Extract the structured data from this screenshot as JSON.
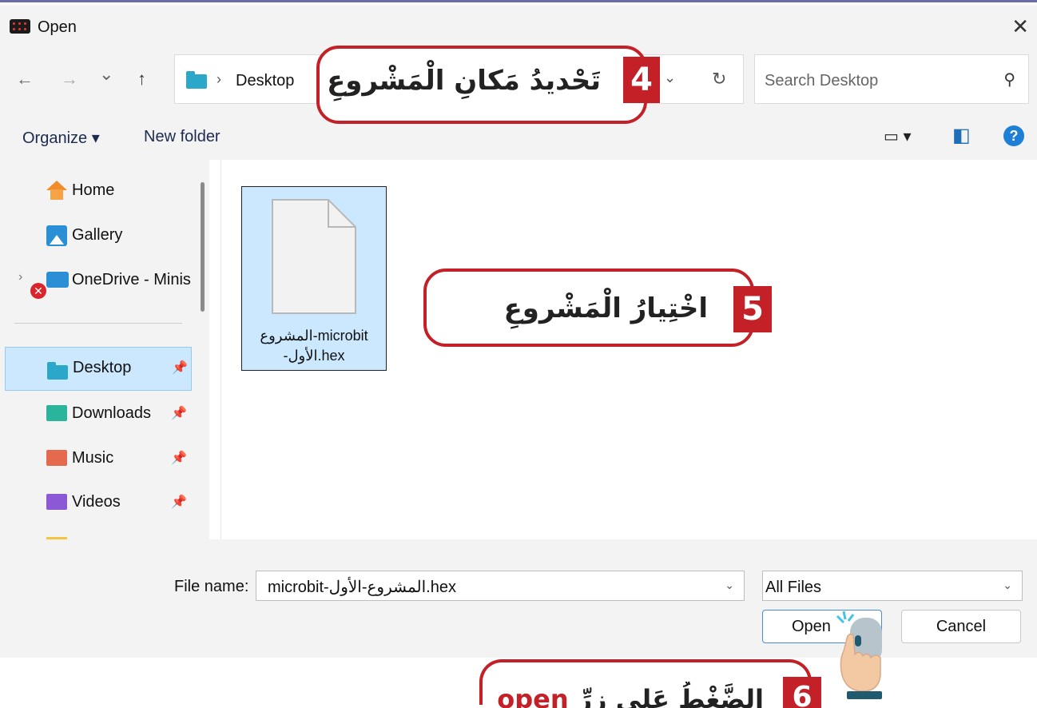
{
  "window": {
    "title": "Open",
    "close_glyph": "✕"
  },
  "nav": {
    "back_glyph": "←",
    "forward_glyph": "→",
    "recent_glyph": "⌄",
    "up_glyph": "↑",
    "breadcrumb_sep": "›",
    "breadcrumb": "Desktop",
    "address_dropdown_glyph": "⌄",
    "refresh_glyph": "↻",
    "search_placeholder": "Search Desktop",
    "search_glyph": "⚲"
  },
  "toolbar": {
    "organize": "Organize ▾",
    "new_folder": "New folder",
    "view_glyph": "▭ ▾",
    "preview_glyph": "◧",
    "help": "?"
  },
  "sidebar": {
    "items": [
      {
        "label": "Home",
        "icon": "home-icon"
      },
      {
        "label": "Gallery",
        "icon": "gallery-icon"
      },
      {
        "label": "OneDrive - Minis",
        "icon": "onedrive-icon",
        "status": "sync-error"
      },
      {
        "label": "Desktop",
        "icon": "desktop-folder-icon",
        "pinned": true,
        "selected": true
      },
      {
        "label": "Downloads",
        "icon": "downloads-folder-icon",
        "pinned": true
      },
      {
        "label": "Music",
        "icon": "music-folder-icon",
        "pinned": true
      },
      {
        "label": "Videos",
        "icon": "videos-folder-icon",
        "pinned": true
      }
    ],
    "pin_glyph": "📌",
    "chevron_glyph": "›",
    "error_glyph": "✕"
  },
  "files": [
    {
      "name_line1": "المشروع-microbit",
      "name_line2": "-الأول.hex",
      "icon": "document-icon",
      "selected": true
    }
  ],
  "footer": {
    "file_name_label": "File name:",
    "file_name_value": "microbit-المشروع-الأول.hex",
    "file_type": "All Files",
    "dropdown_glyph": "⌄",
    "open_button": "Open",
    "cancel_button": "Cancel"
  },
  "annotations": [
    {
      "step": "4",
      "text": "تَحْديدُ مَكانِ الْمَشْروعِ"
    },
    {
      "step": "5",
      "text": "اخْتِيارُ الْمَشْروعِ"
    },
    {
      "step": "6",
      "text": "الضَّغْطُ عَلى زِرِّ",
      "highlight": "open"
    }
  ],
  "colors": {
    "accent_red": "#c42027",
    "selection_blue": "#cce8ff",
    "chrome_gray": "#f3f3f3",
    "help_blue": "#1e7fd6"
  }
}
